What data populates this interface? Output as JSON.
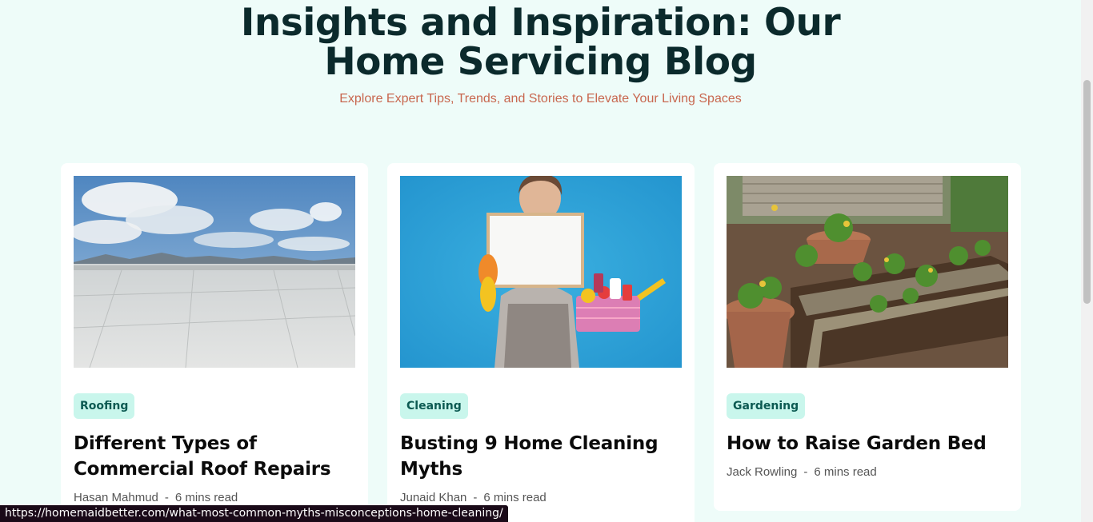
{
  "header": {
    "title_line1": "Insights and Inspiration: Our",
    "title_line2": "Home Servicing Blog",
    "subtitle": "Explore Expert Tips, Trends, and Stories to Elevate Your Living Spaces"
  },
  "posts": [
    {
      "category": "Roofing",
      "title_line1": "Different Types of",
      "title_line2": "Commercial Roof Repairs",
      "author": "Hasan Mahmud",
      "separator": "-",
      "read_time": "6 mins read"
    },
    {
      "category": "Cleaning",
      "title_line1": "Busting 9 Home Cleaning",
      "title_line2": "Myths",
      "author": "Junaid Khan",
      "separator": "-",
      "read_time": "6 mins read"
    },
    {
      "category": "Gardening",
      "title_line1": "How to Raise Garden Bed",
      "title_line2": "",
      "author": "Jack Rowling",
      "separator": "-",
      "read_time": "6 mins read"
    }
  ],
  "status_bar": {
    "url": "https://homemaidbetter.com/what-most-common-myths-misconceptions-home-cleaning/"
  },
  "colors": {
    "background": "#eefcf9",
    "heading": "#0b2a2c",
    "subtitle": "#c8674f",
    "tag_bg": "#c9f6ec",
    "tag_text": "#0c5a52"
  }
}
